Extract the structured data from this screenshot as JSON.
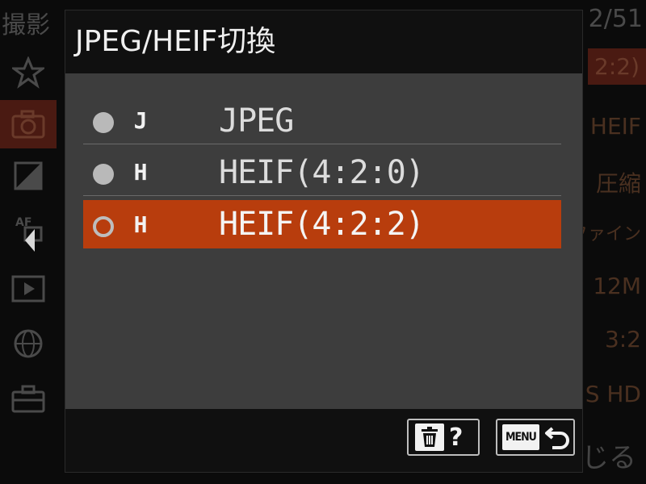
{
  "background": {
    "breadcrumb": "撮影",
    "page_indicator": "2/51",
    "tab_icons": [
      "star-icon",
      "camera-icon",
      "exposure-icon",
      "af-icon",
      "playback-icon",
      "network-icon",
      "toolbox-icon"
    ],
    "values": [
      "2:2)",
      "HEIF",
      "圧縮",
      "ファイン",
      ": 12M",
      "3:2",
      "S HD"
    ],
    "close_label": "じる"
  },
  "dialog": {
    "title": "JPEG/HEIF切換",
    "options": [
      {
        "badge": "J",
        "label": "JPEG",
        "selected": false
      },
      {
        "badge": "H",
        "label": "HEIF(4:2:0)",
        "selected": false
      },
      {
        "badge": "H",
        "label": "HEIF(4:2:2)",
        "selected": true
      }
    ],
    "footer": {
      "help_label": "?",
      "menu_label": "MENU"
    }
  },
  "colors": {
    "selection": "#b83d0d",
    "body": "#3d3d3d",
    "frame": "#101010"
  }
}
